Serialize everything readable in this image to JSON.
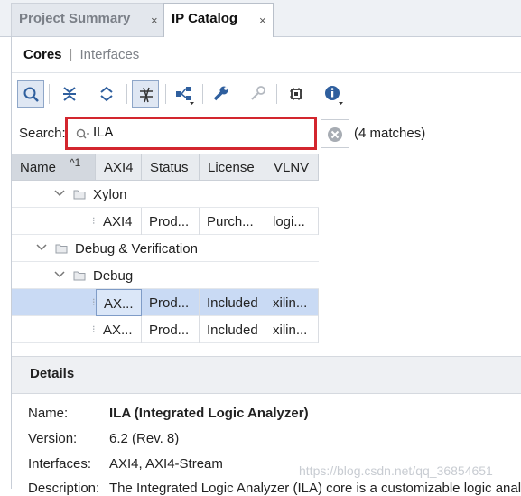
{
  "tabs": [
    {
      "label": "Project Summary",
      "close": "×"
    },
    {
      "label": "IP Catalog",
      "close": "×"
    }
  ],
  "subtabs": {
    "cores": "Cores",
    "separator": "|",
    "interfaces": "Interfaces"
  },
  "search": {
    "label": "Search:",
    "value": "ILA",
    "matches": "(4 matches)"
  },
  "table": {
    "columns": [
      "Name",
      "AXI4",
      "Status",
      "License",
      "VLNV"
    ],
    "sort_indicator": "^1",
    "rows": [
      {
        "type": "folder",
        "name": "Xylon"
      },
      {
        "type": "item",
        "name": "",
        "axi4": "AXI4",
        "status": "Prod...",
        "license": "Purch...",
        "vlnv": "logi..."
      },
      {
        "type": "folder",
        "name": "Debug & Verification"
      },
      {
        "type": "folder",
        "name": "Debug"
      },
      {
        "type": "item",
        "name": "",
        "axi4": "AX...",
        "status": "Prod...",
        "license": "Included",
        "vlnv": "xilin...",
        "selected": true
      },
      {
        "type": "item",
        "name": "",
        "axi4": "AX...",
        "status": "Prod...",
        "license": "Included",
        "vlnv": "xilin..."
      }
    ]
  },
  "details": {
    "title": "Details",
    "fields": [
      {
        "label": "Name:",
        "value": "ILA (Integrated Logic Analyzer)"
      },
      {
        "label": "Version:",
        "value": "6.2 (Rev. 8)"
      },
      {
        "label": "Interfaces:",
        "value": "AXI4, AXI4-Stream"
      },
      {
        "label": "Description:",
        "value": "The Integrated Logic Analyzer (ILA) core is a customizable logic analyzer"
      }
    ]
  },
  "watermark": "https://blog.csdn.net/qq_36854651",
  "colors": {
    "accent": "#d3262e",
    "selection": "#c9daf4",
    "icon_blue": "#2f5f9e"
  }
}
